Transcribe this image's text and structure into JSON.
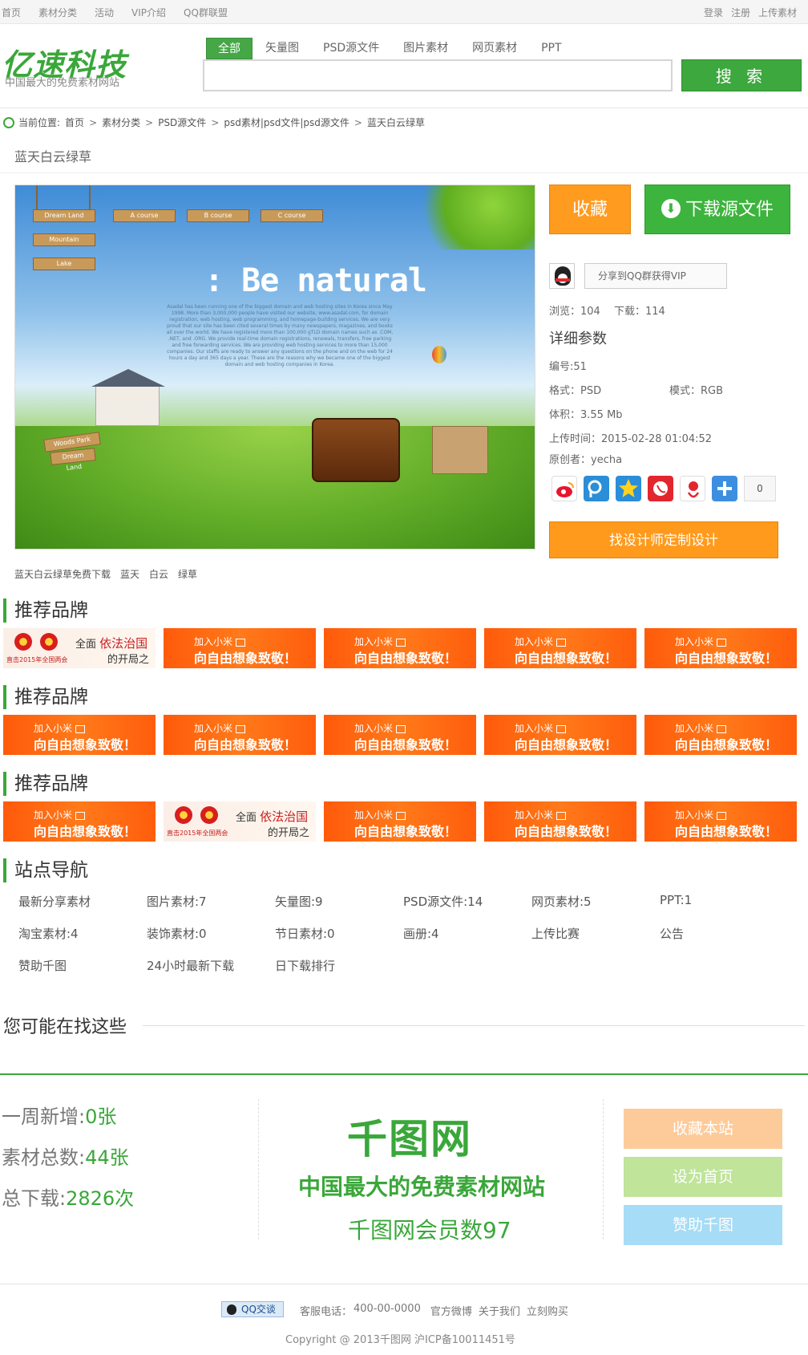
{
  "topbar": {
    "left": [
      "首页",
      "素材分类",
      "活动",
      "VIP介绍",
      "QQ群联盟"
    ],
    "right": [
      "登录",
      "注册",
      "上传素材"
    ]
  },
  "header": {
    "logo": "亿速科技",
    "logo_sub": "中国最大的免费素材网站",
    "tabs": [
      "全部",
      "矢量图",
      "PSD源文件",
      "图片素材",
      "网页素材",
      "PPT"
    ],
    "search_placeholder": "",
    "search_button": "搜 索"
  },
  "breadcrumb": {
    "label": "当前位置:",
    "items": [
      "首页",
      "素材分类",
      "PSD源文件",
      "psd素材|psd文件|psd源文件",
      "蓝天白云绿草"
    ]
  },
  "page_title": "蓝天白云绿草",
  "preview": {
    "headline": ": Be natural",
    "paragraph": "Asadal has been running one of the biggest domain and web hosting sites in Korea since May 1998. More than 3,000,000 people have visited our website, www.asadal.com, for domain registration, web hosting, web programming, and homepage-building services. We are very proud that our site has been cited several times by many newspapers, magazines, and books all over the world. We have registered more than 100,000 gTLD domain names such as .COM, .NET, and .ORG. We provide real-time domain registrations, renewals, transfers, free parking and free forwarding services. We are providing web hosting services to more than 15,000 companies. Our staffs are ready to answer any questions on the phone and on the web for 24 hours a day and 365 days a year. These are the reasons why we became one of the biggest domain and web hosting companies in Korea.",
    "signs": [
      "Dream Land",
      "A course",
      "B course",
      "C course",
      "Mountain",
      "Lake"
    ],
    "woods_sign": "Woods Park",
    "woods_sub": "Dream Land"
  },
  "actions": {
    "favorite": "收藏",
    "download": "下载源文件",
    "qq_share": "分享到QQ群获得VIP",
    "designer": "找设计师定制设计",
    "share_count": "0"
  },
  "stats": {
    "views_label": "浏览：",
    "views": "104",
    "downloads_label": "下载：",
    "downloads": "114"
  },
  "params": {
    "title": "详细参数",
    "id": "编号:51",
    "format": "格式：PSD",
    "mode": "模式：RGB",
    "size": "体积：3.55 Mb",
    "uploaded": "上传时间：2015-02-28 01:04:52",
    "author": "原创者：yecha"
  },
  "share_icons": [
    "weibo-icon",
    "tencent-weibo-icon",
    "qzone-icon",
    "renren-icon",
    "kaixin-icon",
    "more-plus-icon"
  ],
  "tags": [
    "蓝天白云绿草免费下载",
    "蓝天",
    "白云",
    "绿草"
  ],
  "brands": {
    "title": "推荐品牌",
    "orange_line1": "加入小米",
    "orange_line2": "向自由想象致敬！",
    "gov_line1a": "全面",
    "gov_line1b": "依法治国",
    "gov_line2": "的开局之",
    "gov_line3": "直击2015年全国两会"
  },
  "site_nav": {
    "title": "站点导航",
    "items": [
      "最新分享素材",
      "图片素材:7",
      "矢量图:9",
      "PSD源文件:14",
      "网页素材:5",
      "PPT:1",
      "淘宝素材:4",
      "装饰素材:0",
      "节日素材:0",
      "画册:4",
      "上传比赛",
      "公告",
      "赞助千图",
      "24小时最新下载",
      "日下载排行"
    ]
  },
  "maybe": {
    "title": "您可能在找这些"
  },
  "footer": {
    "week_label": "一周新增:",
    "week_value": "0张",
    "total_label": "素材总数:",
    "total_value": "44张",
    "dl_label": "总下载:",
    "dl_value": "2826次",
    "brand": "千图网",
    "slogan": "中国最大的免费素材网站",
    "members": "千图网会员数97",
    "buttons": [
      "收藏本站",
      "设为首页",
      "赞助千图"
    ],
    "qq_talk": "QQ交谈",
    "links": [
      "客服电话：",
      "400-00-0000",
      "官方微博",
      "关于我们",
      "立刻购买"
    ],
    "copyright": "Copyright @ 2013千图网 沪ICP备10011451号"
  },
  "colors": {
    "brand_green": "#3aa73a",
    "orange": "#ff9b1f",
    "download_green": "#3db43d",
    "banner_orange": "#ff5a0a",
    "fav_soft": "#fdcb9a",
    "home_soft": "#bfe49a",
    "sponsor_soft": "#a6dcf5"
  }
}
